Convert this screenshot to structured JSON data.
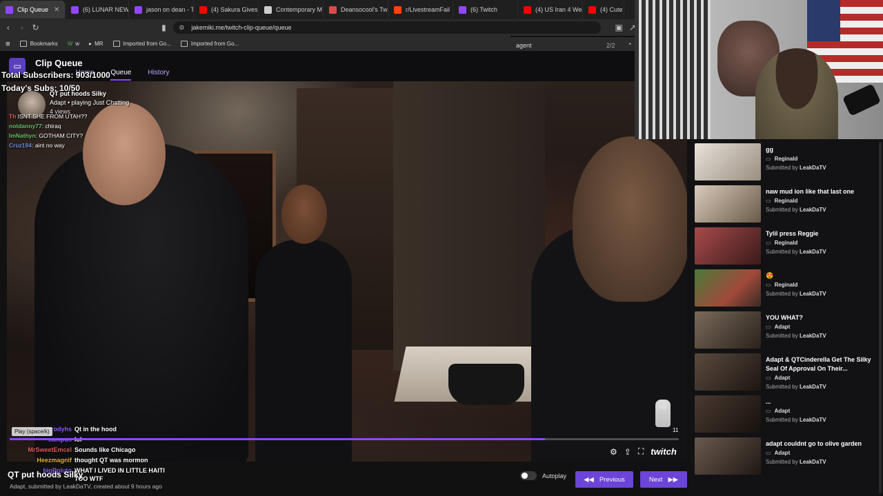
{
  "browser": {
    "tabs": [
      {
        "label": "Clip Queue",
        "color": "#9147ff",
        "active": true
      },
      {
        "label": "(6) LUNAR NEW",
        "color": "#9147ff"
      },
      {
        "label": "jason on dean - T",
        "color": "#9147ff"
      },
      {
        "label": "(4) Sakura Gives",
        "color": "#ff0000"
      },
      {
        "label": "Contemporary M",
        "color": "#cccccc"
      },
      {
        "label": "Deansocool's Tw",
        "color": "#d94b4b"
      },
      {
        "label": "r/LivestreamFail",
        "color": "#ff4500"
      },
      {
        "label": "(6) Twitch",
        "color": "#9147ff"
      },
      {
        "label": "(4) US Iran 4 Wee",
        "color": "#ff0000"
      },
      {
        "label": "(4) Cute",
        "color": "#ff0000"
      }
    ],
    "url": "jakemiki.me/twitch-clip-queue/queue",
    "find": {
      "query": "agent",
      "count": "2/2"
    },
    "bookmarks": [
      "Bookmarks",
      "w",
      "MR",
      "Imported from Go...",
      "Imported from Go..."
    ]
  },
  "app": {
    "title": "Clip Queue",
    "nav": [
      "Home",
      "Queue",
      "History"
    ]
  },
  "overlay": {
    "subs_total": "Total Subscribers: 903/1000",
    "subs_today": "Today's Subs: 10/50",
    "clip_title": "QT put hoods Silky",
    "clip_channel": "Adapt • playing Just Chatting",
    "clip_views": "4 views",
    "chat_top": [
      {
        "user": "Th",
        "color": "#e05a5a",
        "msg": "ISNT SHE FROM UTAH??"
      },
      {
        "user": "notdanny77",
        "color": "#63c06a",
        "msg": "chiraq"
      },
      {
        "user": "ImNathyn",
        "color": "#63c06a",
        "msg": "GOTHAM CITY?"
      },
      {
        "user": "Cruz194",
        "color": "#6a8ee0",
        "msg": "aint no way"
      }
    ],
    "chat_bottom": [
      {
        "user": "brodyhs",
        "color": "#8a5cff",
        "msg": "Qt in the hood"
      },
      {
        "user": "campus",
        "color": "#8a5cff",
        "msg": "lol"
      },
      {
        "user": "MrSweetEmcel",
        "color": "#e05a5a",
        "msg": "Sounds like Chicago"
      },
      {
        "user": "Heezmagnif",
        "color": "#e0b23a",
        "msg": "thought QT was mormon"
      },
      {
        "user": "bigPpluto",
        "color": "#8a5cff",
        "msg": "WHAT I LIVED IN LITTLE HAITI"
      },
      {
        "user": "",
        "color": "#ffffff",
        "msg": "TOO WTF"
      }
    ],
    "play_tooltip": "Play (space/k)",
    "timer": "11",
    "progress": 0.8,
    "twitch_wordmark": "twitch"
  },
  "player": {
    "title": "QT put hoods Silky",
    "submeta": "Adapt, submitted by LeakDaTV, created about 9 hours ago",
    "autoplay_label": "Autoplay",
    "prev_label": "Previous",
    "next_label": "Next"
  },
  "queue": [
    {
      "title": "gg",
      "channel": "Reginald",
      "submitter": "LeakDaTV",
      "thumb": "#d8d0c8"
    },
    {
      "title": "naw mud ion like that last one",
      "channel": "Reginald",
      "submitter": "LeakDaTV",
      "thumb": "#b8a898"
    },
    {
      "title": "Tylil press Reggie",
      "channel": "Reginald",
      "submitter": "LeakDaTV",
      "thumb": "#8a3a3a"
    },
    {
      "title": "😍",
      "channel": "Reginald",
      "submitter": "LeakDaTV",
      "thumb": "#5a8a4a"
    },
    {
      "title": "YOU WHAT?",
      "channel": "Adapt",
      "submitter": "LeakDaTV",
      "thumb": "#6a5a4a"
    },
    {
      "title": "Adapt & QTCinderella Get The Silky Seal Of Approval On Their...",
      "channel": "Adapt",
      "submitter": "LeakDaTV",
      "thumb": "#4a3a30"
    },
    {
      "title": "...",
      "channel": "Adapt",
      "submitter": "LeakDaTV",
      "thumb": "#3a2c26"
    },
    {
      "title": "adapt couldnt go to olive garden",
      "channel": "Adapt",
      "submitter": "LeakDaTV",
      "thumb": "#5a4a40"
    }
  ],
  "queue_labels": {
    "submitted_by": "Submitted by"
  }
}
